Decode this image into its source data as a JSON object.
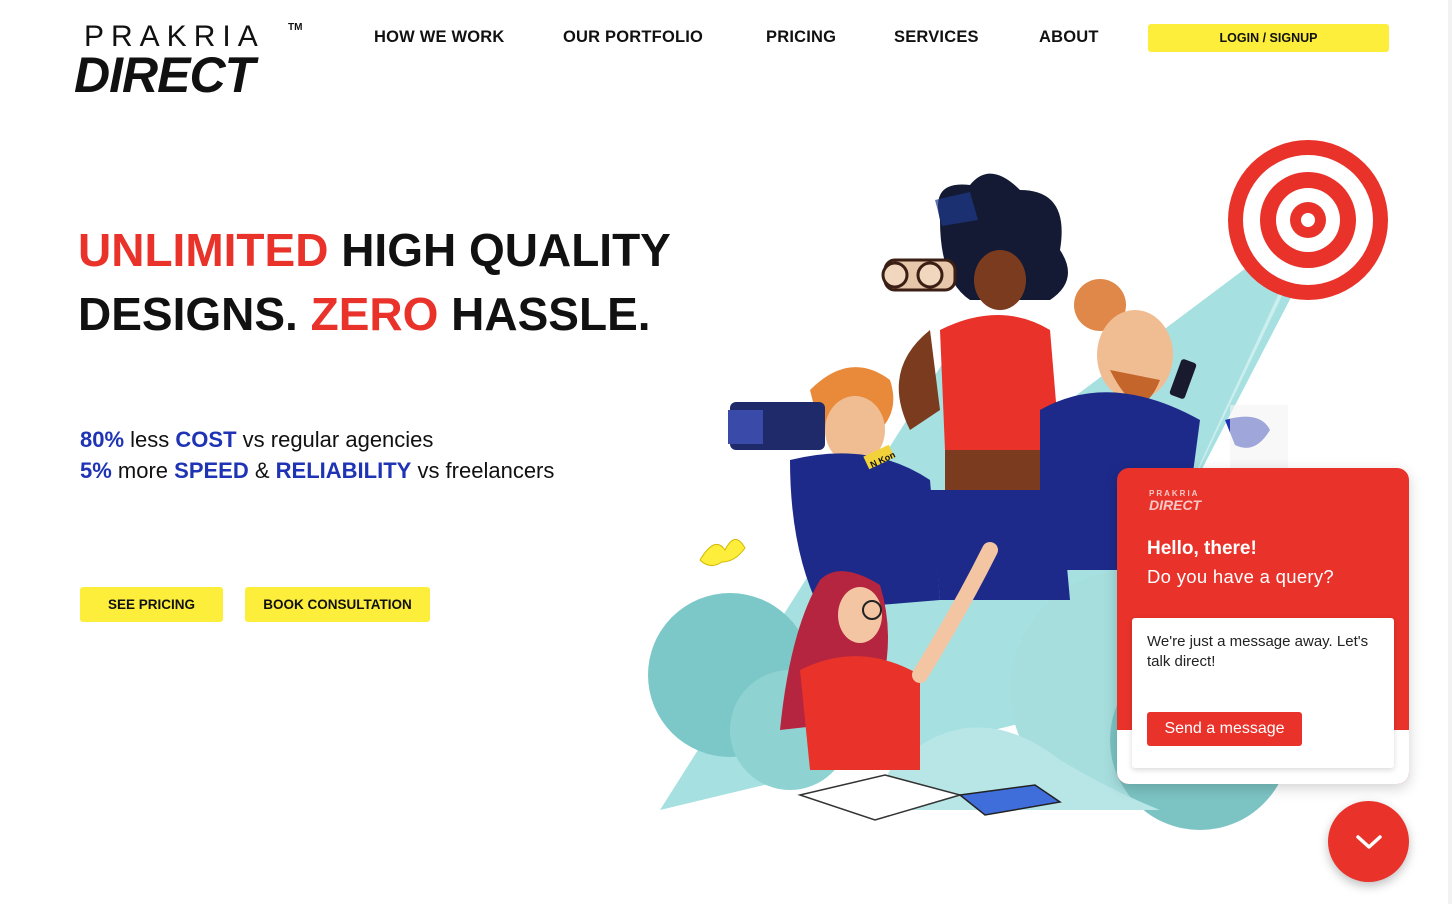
{
  "header": {
    "logo_top": "PRAKRIA",
    "logo_tm": "TM",
    "logo_bottom": "DIRECT",
    "nav": [
      "HOW WE WORK",
      "OUR PORTFOLIO",
      "PRICING",
      "SERVICES",
      "ABOUT"
    ],
    "login_label": "LOGIN / SIGNUP"
  },
  "hero": {
    "line1_red": "UNLIMITED",
    "line1_black": " HIGH QUALITY",
    "line2_black_a": "DESIGNS. ",
    "line2_red": "ZERO",
    "line2_black_b": " HASSLE.",
    "stat1_num": "80%",
    "stat1_mid": " less ",
    "stat1_key": "COST",
    "stat1_rest": " vs regular agencies",
    "stat2_num": "5%",
    "stat2_mid": " more ",
    "stat2_key1": "SPEED",
    "stat2_amp": " & ",
    "stat2_key2": "RELIABILITY",
    "stat2_rest": " vs freelancers",
    "cta_pricing": "SEE PRICING",
    "cta_consult": "BOOK CONSULTATION",
    "camera_label": "N Kon"
  },
  "chat": {
    "logo_top": "PRAKRIA",
    "logo_bottom": "DIRECT",
    "greeting": "Hello, there!",
    "query": "Do you have a query?",
    "message": "We're just a message away. Let's talk direct!",
    "send_label": "Send a message",
    "toggle_icon": "chevron-down-icon"
  },
  "colors": {
    "brand_red": "#e8322a",
    "accent_yellow": "#fcee3a",
    "stat_blue": "#1f33b5",
    "teal": "#9fd8d8"
  }
}
